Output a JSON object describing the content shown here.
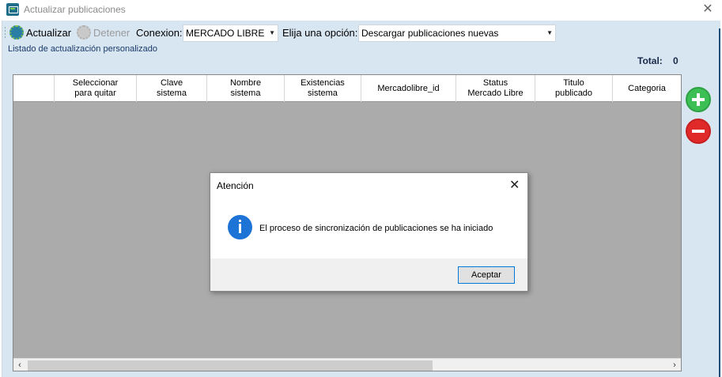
{
  "window": {
    "title": "Actualizar publicaciones"
  },
  "toolbar": {
    "actualizar_label": "Actualizar",
    "detener_label": "Detener",
    "conexion_label": "Conexion:",
    "conexion_value": "MERCADO LIBRE",
    "opcion_label": "Elija una opción:",
    "opcion_value": "Descargar publicaciones nuevas"
  },
  "list": {
    "label": "Listado de actualización personalizado",
    "total_label": "Total:",
    "total_value": "0"
  },
  "grid": {
    "columns": [
      "",
      "Seleccionar\npara quitar",
      "Clave\nsistema",
      "Nombre\nsistema",
      "Existencias\nsistema",
      "Mercadolibre_id",
      "Status\nMercado Libre",
      "Titulo\npublicado",
      "Categoria"
    ]
  },
  "dialog": {
    "title": "Atención",
    "message": "El proceso de sincronización de publicaciones se ha iniciado",
    "accept_label": "Aceptar"
  },
  "colors": {
    "client_bg": "#d8e6f2",
    "add_green": "#3cbf55",
    "remove_red": "#e02a2a",
    "info_blue": "#1e74d6"
  },
  "icons": [
    "app-icon",
    "close-icon",
    "gear-icon",
    "add-icon",
    "remove-icon",
    "info-icon",
    "chevron-down-icon"
  ]
}
